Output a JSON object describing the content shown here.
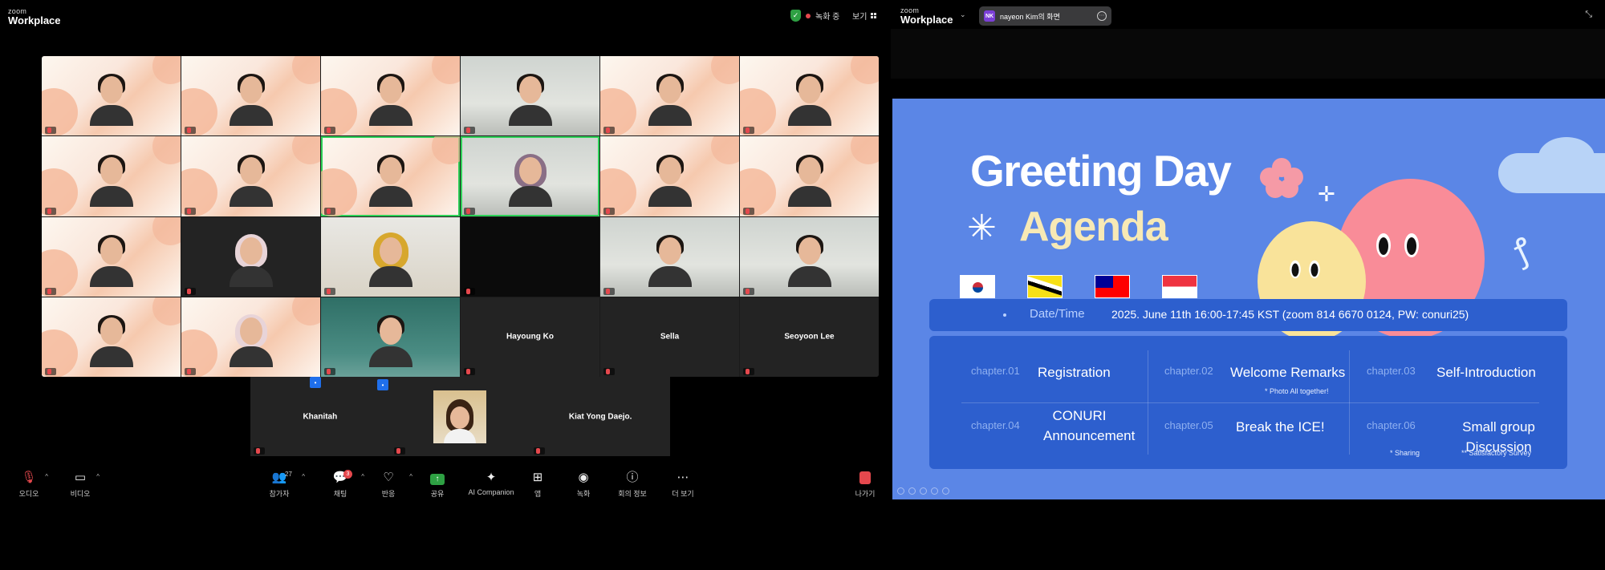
{
  "left_window": {
    "logo_small": "zoom",
    "logo_big": "Workplace",
    "recording_label": "녹화 중",
    "view_label": "보기",
    "gallery": [
      {
        "name": "",
        "bg": "slide",
        "person": "plain"
      },
      {
        "name": "",
        "bg": "slide",
        "person": "plain"
      },
      {
        "name": "",
        "bg": "slide",
        "person": "plain"
      },
      {
        "name": "",
        "bg": "room",
        "person": "plain"
      },
      {
        "name": "",
        "bg": "slide",
        "person": "plain"
      },
      {
        "name": "",
        "bg": "slide",
        "person": "plain"
      },
      {
        "name": "",
        "bg": "slide",
        "person": "plain"
      },
      {
        "name": "",
        "bg": "slide",
        "person": "plain"
      },
      {
        "name": "",
        "bg": "slide",
        "person": "plain"
      },
      {
        "name": "",
        "bg": "room",
        "person": "hijab-dark"
      },
      {
        "name": "",
        "bg": "slide",
        "person": "plain"
      },
      {
        "name": "",
        "bg": "slide",
        "person": "plain"
      },
      {
        "name": "",
        "bg": "slide",
        "person": "plain"
      },
      {
        "name": "",
        "bg": "dark",
        "person": "hijab"
      },
      {
        "name": "",
        "bg": "yellow",
        "person": "hijab-yellow"
      },
      {
        "name": "",
        "bg": "black",
        "person": "none"
      },
      {
        "name": "",
        "bg": "room",
        "person": "plain"
      },
      {
        "name": "",
        "bg": "room",
        "person": "plain"
      },
      {
        "name": "",
        "bg": "slide",
        "person": "plain"
      },
      {
        "name": "",
        "bg": "slide",
        "person": "hijab"
      },
      {
        "name": "",
        "bg": "green",
        "person": "plain"
      },
      {
        "name": "Hayoung Ko",
        "bg": "dark",
        "person": "none"
      },
      {
        "name": "Sella",
        "bg": "dark",
        "person": "none"
      },
      {
        "name": "Seoyoon Lee",
        "bg": "dark",
        "person": "none"
      }
    ],
    "gallery_row5": [
      {
        "name": "Khanitah",
        "bg": "dark",
        "person": "none"
      },
      {
        "name": "",
        "bg": "photo",
        "person": "plain"
      },
      {
        "name": "Kiat Yong Daejo.",
        "bg": "dark",
        "person": "none"
      }
    ],
    "toolbar": {
      "audio": "오디오",
      "video": "비디오",
      "participants": "참가자",
      "participants_count": "27",
      "chat": "채팅",
      "chat_badge": "3",
      "reactions": "반응",
      "share": "공유",
      "ai_companion": "AI Companion",
      "apps": "앱",
      "record": "녹화",
      "meeting_info": "회의 정보",
      "more": "더 보기",
      "leave": "나가기"
    }
  },
  "right_window": {
    "logo_small": "zoom",
    "logo_big": "Workplace",
    "share_avatar": "NK",
    "share_label": "nayeon Kim의 화면",
    "slide": {
      "title": "Greeting Day",
      "subtitle": "Agenda",
      "date_label": "Date/Time",
      "date_value": "2025. June 11th 16:00-17:45 KST (zoom 814 6670 0124, PW: conuri25)",
      "chapters": [
        {
          "num": "chapter.01",
          "title": "Registration",
          "note": ""
        },
        {
          "num": "chapter.02",
          "title": "Welcome Remarks",
          "note": "* Photo All together!"
        },
        {
          "num": "chapter.03",
          "title": "Self-Introduction",
          "note": ""
        },
        {
          "num": "chapter.04",
          "title": "CONURI Announcement",
          "note": ""
        },
        {
          "num": "chapter.05",
          "title": "Break the ICE!",
          "note": ""
        },
        {
          "num": "chapter.06",
          "title": "Small group Discussion",
          "note": "* Sharing",
          "note2": "** Satisfactory Survey"
        }
      ]
    }
  }
}
